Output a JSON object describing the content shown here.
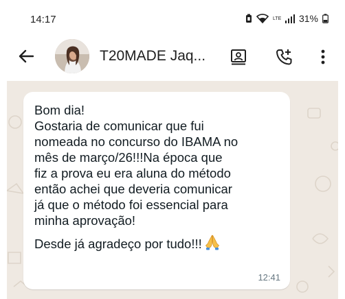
{
  "status_bar": {
    "time": "14:17",
    "network_label": "LTE",
    "battery": "31%"
  },
  "header": {
    "title": "T20MADE Jaq..."
  },
  "message": {
    "lines": [
      "Bom dia!",
      "Gostaria de comunicar que fui",
      "nomeada no concurso do IBAMA no",
      "mês de março/26!!!Na época que",
      "fiz a prova eu era aluna do método",
      "então achei que deveria comunicar",
      "já que o método foi essencial para",
      "minha aprovação!"
    ],
    "closing": "Desde já agradeço por tudo!!!",
    "emoji": "folded-hands",
    "time": "12:41"
  },
  "colors": {
    "chat_wallpaper": "#efe9e2",
    "bubble": "#ffffff",
    "text": "#111b21",
    "meta": "#667781"
  },
  "icons": [
    "arrow-back-icon",
    "contact-card-icon",
    "add-call-icon",
    "more-vert-icon",
    "battery-icon",
    "wifi-icon",
    "signal-icon"
  ]
}
